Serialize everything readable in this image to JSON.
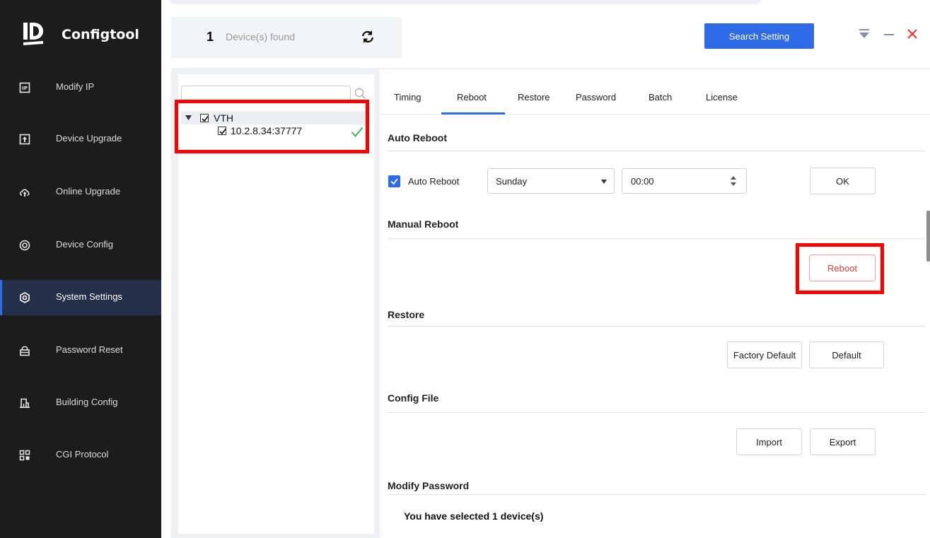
{
  "app": {
    "name": "Configtool"
  },
  "sidebar": {
    "items": [
      {
        "label": "Modify IP",
        "icon": "ip-icon",
        "active": false
      },
      {
        "label": "Device Upgrade",
        "icon": "upload-box-icon",
        "active": false
      },
      {
        "label": "Online Upgrade",
        "icon": "cloud-upload-icon",
        "active": false
      },
      {
        "label": "Device Config",
        "icon": "target-icon",
        "active": false
      },
      {
        "label": "System Settings",
        "icon": "settings-hex-icon",
        "active": true
      },
      {
        "label": "Password Reset",
        "icon": "lock-icon",
        "active": false
      },
      {
        "label": "Building Config",
        "icon": "building-icon",
        "active": false
      },
      {
        "label": "CGI Protocol",
        "icon": "grid-icon",
        "active": false
      }
    ],
    "accent": "#2f6be6"
  },
  "topbar": {
    "device_count": "1",
    "device_found_label": "Device(s) found",
    "search_setting_label": "Search Setting"
  },
  "tree": {
    "search_placeholder": "",
    "group_label": "VTH",
    "device_label": "10.2.8.34:37777"
  },
  "tabs": [
    {
      "label": "Timing",
      "active": false
    },
    {
      "label": "Reboot",
      "active": true
    },
    {
      "label": "Restore",
      "active": false
    },
    {
      "label": "Password",
      "active": false
    },
    {
      "label": "Batch",
      "active": false
    },
    {
      "label": "License",
      "active": false
    }
  ],
  "auto_reboot": {
    "title": "Auto Reboot",
    "checkbox_label": "Auto Reboot",
    "checked": true,
    "day": "Sunday",
    "time": "00:00",
    "ok_label": "OK"
  },
  "manual_reboot": {
    "title": "Manual Reboot",
    "reboot_label": "Reboot"
  },
  "restore": {
    "title": "Restore",
    "factory_default_label": "Factory Default",
    "default_label": "Default"
  },
  "config_file": {
    "title": "Config File",
    "import_label": "Import",
    "export_label": "Export"
  },
  "modify_password": {
    "title": "Modify Password",
    "selected_text": "You have selected 1 device(s)"
  }
}
